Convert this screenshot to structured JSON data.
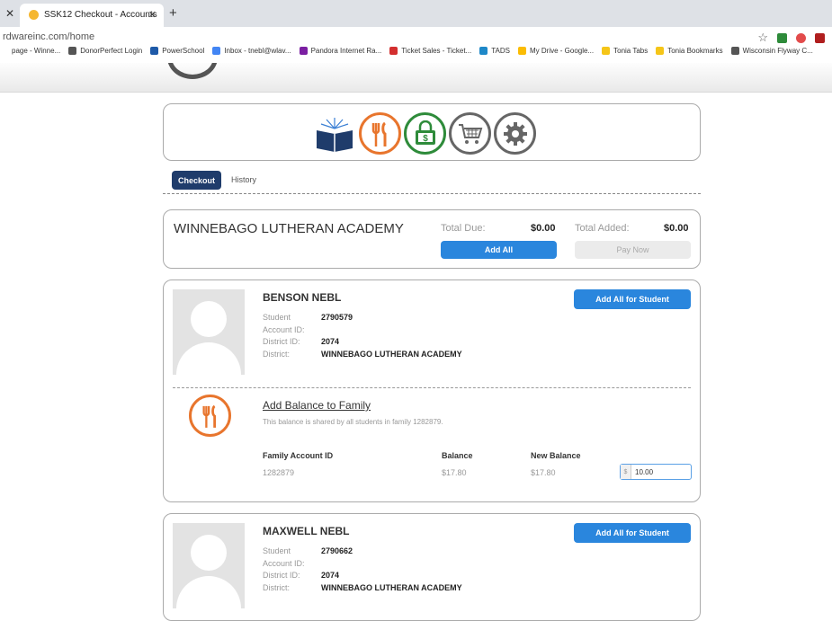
{
  "browser": {
    "tab_title": "SSK12 Checkout - Accounts",
    "url": "rdwareinc.com/home",
    "bookmarks": [
      {
        "label": "page - Winne...",
        "color": "#ffffff"
      },
      {
        "label": "DonorPerfect Login",
        "color": "#555555"
      },
      {
        "label": "PowerSchool",
        "color": "#1e5aa8"
      },
      {
        "label": "Inbox - tnebl@wlav...",
        "color": "#4285f4"
      },
      {
        "label": "Pandora Internet Ra...",
        "color": "#7b1fa2"
      },
      {
        "label": "Ticket Sales - Ticket...",
        "color": "#d32f2f"
      },
      {
        "label": "TADS",
        "color": "#1e88c8"
      },
      {
        "label": "My Drive - Google...",
        "color": "#fbbc04"
      },
      {
        "label": "Tonia Tabs",
        "color": "#f5c518"
      },
      {
        "label": "Tonia Bookmarks",
        "color": "#f5c518"
      },
      {
        "label": "Wisconsin Flyway C...",
        "color": "#555555"
      }
    ]
  },
  "nav_icons": [
    {
      "name": "books-icon",
      "color": "#1f3c6b"
    },
    {
      "name": "fork-knife-icon",
      "color": "#e8752d"
    },
    {
      "name": "money-icon",
      "color": "#2e8b3a"
    },
    {
      "name": "shopping-cart-icon",
      "color": "#666666"
    },
    {
      "name": "gear-icon",
      "color": "#666666"
    }
  ],
  "tabs": {
    "checkout": "Checkout",
    "history": "History"
  },
  "school": {
    "name": "WINNEBAGO LUTHERAN ACADEMY",
    "total_due_label": "Total Due:",
    "total_due": "$0.00",
    "total_added_label": "Total Added:",
    "total_added": "$0.00",
    "add_all": "Add All",
    "pay_now": "Pay Now"
  },
  "labels": {
    "student": "Student",
    "account_id": "Account ID:",
    "district_id": "District ID:",
    "district": "District:",
    "add_all_student": "Add All for Student"
  },
  "students": [
    {
      "name": "BENSON NEBL",
      "student_id": "2790579",
      "district_id": "2074",
      "district": "WINNEBAGO LUTHERAN ACADEMY"
    },
    {
      "name": "MAXWELL NEBL",
      "student_id": "2790662",
      "district_id": "2074",
      "district": "WINNEBAGO LUTHERAN ACADEMY"
    }
  ],
  "family_balance": {
    "title": "Add Balance to Family",
    "description": "This balance is shared by all students in family 1282879.",
    "col_account": "Family Account ID",
    "col_balance": "Balance",
    "col_new_balance": "New Balance",
    "account_id": "1282879",
    "balance": "$17.80",
    "new_balance": "$17.80",
    "currency": "$",
    "amount": "10.00"
  }
}
